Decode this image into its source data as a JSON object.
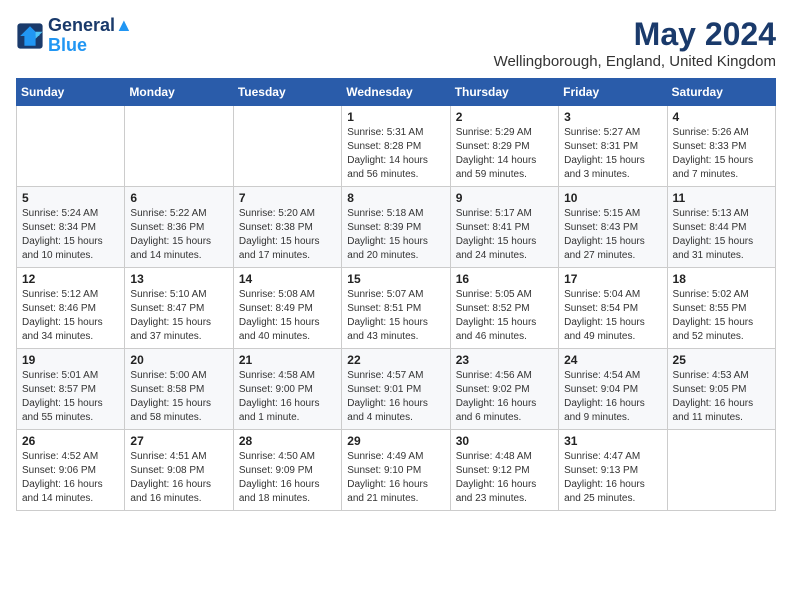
{
  "header": {
    "logo_line1": "General",
    "logo_line2": "Blue",
    "month": "May 2024",
    "location": "Wellingborough, England, United Kingdom"
  },
  "weekdays": [
    "Sunday",
    "Monday",
    "Tuesday",
    "Wednesday",
    "Thursday",
    "Friday",
    "Saturday"
  ],
  "weeks": [
    [
      {
        "day": "",
        "info": ""
      },
      {
        "day": "",
        "info": ""
      },
      {
        "day": "",
        "info": ""
      },
      {
        "day": "1",
        "info": "Sunrise: 5:31 AM\nSunset: 8:28 PM\nDaylight: 14 hours\nand 56 minutes."
      },
      {
        "day": "2",
        "info": "Sunrise: 5:29 AM\nSunset: 8:29 PM\nDaylight: 14 hours\nand 59 minutes."
      },
      {
        "day": "3",
        "info": "Sunrise: 5:27 AM\nSunset: 8:31 PM\nDaylight: 15 hours\nand 3 minutes."
      },
      {
        "day": "4",
        "info": "Sunrise: 5:26 AM\nSunset: 8:33 PM\nDaylight: 15 hours\nand 7 minutes."
      }
    ],
    [
      {
        "day": "5",
        "info": "Sunrise: 5:24 AM\nSunset: 8:34 PM\nDaylight: 15 hours\nand 10 minutes."
      },
      {
        "day": "6",
        "info": "Sunrise: 5:22 AM\nSunset: 8:36 PM\nDaylight: 15 hours\nand 14 minutes."
      },
      {
        "day": "7",
        "info": "Sunrise: 5:20 AM\nSunset: 8:38 PM\nDaylight: 15 hours\nand 17 minutes."
      },
      {
        "day": "8",
        "info": "Sunrise: 5:18 AM\nSunset: 8:39 PM\nDaylight: 15 hours\nand 20 minutes."
      },
      {
        "day": "9",
        "info": "Sunrise: 5:17 AM\nSunset: 8:41 PM\nDaylight: 15 hours\nand 24 minutes."
      },
      {
        "day": "10",
        "info": "Sunrise: 5:15 AM\nSunset: 8:43 PM\nDaylight: 15 hours\nand 27 minutes."
      },
      {
        "day": "11",
        "info": "Sunrise: 5:13 AM\nSunset: 8:44 PM\nDaylight: 15 hours\nand 31 minutes."
      }
    ],
    [
      {
        "day": "12",
        "info": "Sunrise: 5:12 AM\nSunset: 8:46 PM\nDaylight: 15 hours\nand 34 minutes."
      },
      {
        "day": "13",
        "info": "Sunrise: 5:10 AM\nSunset: 8:47 PM\nDaylight: 15 hours\nand 37 minutes."
      },
      {
        "day": "14",
        "info": "Sunrise: 5:08 AM\nSunset: 8:49 PM\nDaylight: 15 hours\nand 40 minutes."
      },
      {
        "day": "15",
        "info": "Sunrise: 5:07 AM\nSunset: 8:51 PM\nDaylight: 15 hours\nand 43 minutes."
      },
      {
        "day": "16",
        "info": "Sunrise: 5:05 AM\nSunset: 8:52 PM\nDaylight: 15 hours\nand 46 minutes."
      },
      {
        "day": "17",
        "info": "Sunrise: 5:04 AM\nSunset: 8:54 PM\nDaylight: 15 hours\nand 49 minutes."
      },
      {
        "day": "18",
        "info": "Sunrise: 5:02 AM\nSunset: 8:55 PM\nDaylight: 15 hours\nand 52 minutes."
      }
    ],
    [
      {
        "day": "19",
        "info": "Sunrise: 5:01 AM\nSunset: 8:57 PM\nDaylight: 15 hours\nand 55 minutes."
      },
      {
        "day": "20",
        "info": "Sunrise: 5:00 AM\nSunset: 8:58 PM\nDaylight: 15 hours\nand 58 minutes."
      },
      {
        "day": "21",
        "info": "Sunrise: 4:58 AM\nSunset: 9:00 PM\nDaylight: 16 hours\nand 1 minute."
      },
      {
        "day": "22",
        "info": "Sunrise: 4:57 AM\nSunset: 9:01 PM\nDaylight: 16 hours\nand 4 minutes."
      },
      {
        "day": "23",
        "info": "Sunrise: 4:56 AM\nSunset: 9:02 PM\nDaylight: 16 hours\nand 6 minutes."
      },
      {
        "day": "24",
        "info": "Sunrise: 4:54 AM\nSunset: 9:04 PM\nDaylight: 16 hours\nand 9 minutes."
      },
      {
        "day": "25",
        "info": "Sunrise: 4:53 AM\nSunset: 9:05 PM\nDaylight: 16 hours\nand 11 minutes."
      }
    ],
    [
      {
        "day": "26",
        "info": "Sunrise: 4:52 AM\nSunset: 9:06 PM\nDaylight: 16 hours\nand 14 minutes."
      },
      {
        "day": "27",
        "info": "Sunrise: 4:51 AM\nSunset: 9:08 PM\nDaylight: 16 hours\nand 16 minutes."
      },
      {
        "day": "28",
        "info": "Sunrise: 4:50 AM\nSunset: 9:09 PM\nDaylight: 16 hours\nand 18 minutes."
      },
      {
        "day": "29",
        "info": "Sunrise: 4:49 AM\nSunset: 9:10 PM\nDaylight: 16 hours\nand 21 minutes."
      },
      {
        "day": "30",
        "info": "Sunrise: 4:48 AM\nSunset: 9:12 PM\nDaylight: 16 hours\nand 23 minutes."
      },
      {
        "day": "31",
        "info": "Sunrise: 4:47 AM\nSunset: 9:13 PM\nDaylight: 16 hours\nand 25 minutes."
      },
      {
        "day": "",
        "info": ""
      }
    ]
  ]
}
